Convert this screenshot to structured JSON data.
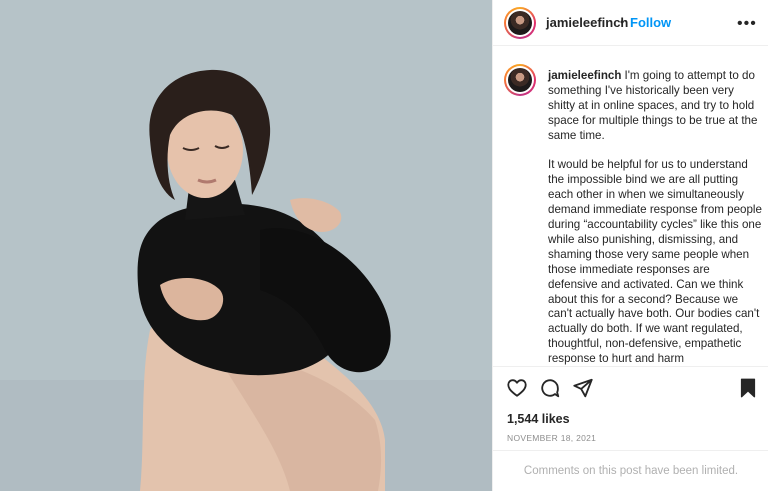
{
  "post": {
    "username": "jamieleefinch",
    "separator": "•",
    "follow_label": "Follow",
    "more_options_icon": "more-horizontal-icon",
    "more_glyph": "•••",
    "photo_description_icon": "post-photo",
    "caption_paragraph_1": "I'm going to attempt to do something I've historically been very shitty at in online spaces, and try to hold space for multiple things to be true at the same time.",
    "caption_paragraph_2": "It would be helpful for us to understand the impossible bind we are all putting each other in when we simultaneously demand immediate response from people during “accountability cycles” like this one while also punishing, dismissing, and shaming those very same people when those immediate responses are defensive and activated. Can we think about this for a second? Because we can't actually have both. Our bodies can't actually do both. If we want regulated, thoughtful, non-defensive, empathetic response to hurt and harm",
    "likes": "1,544 likes",
    "date": "NOVEMBER 18, 2021",
    "comments_limited": "Comments on this post have been limited."
  },
  "actions": {
    "like_icon": "heart-icon",
    "comment_icon": "comment-icon",
    "share_icon": "share-icon",
    "save_icon": "bookmark-icon"
  },
  "colors": {
    "follow_blue": "#0095f6",
    "text": "#262626",
    "muted": "#8e8e8e",
    "photo_background": "#b6c3c8"
  }
}
